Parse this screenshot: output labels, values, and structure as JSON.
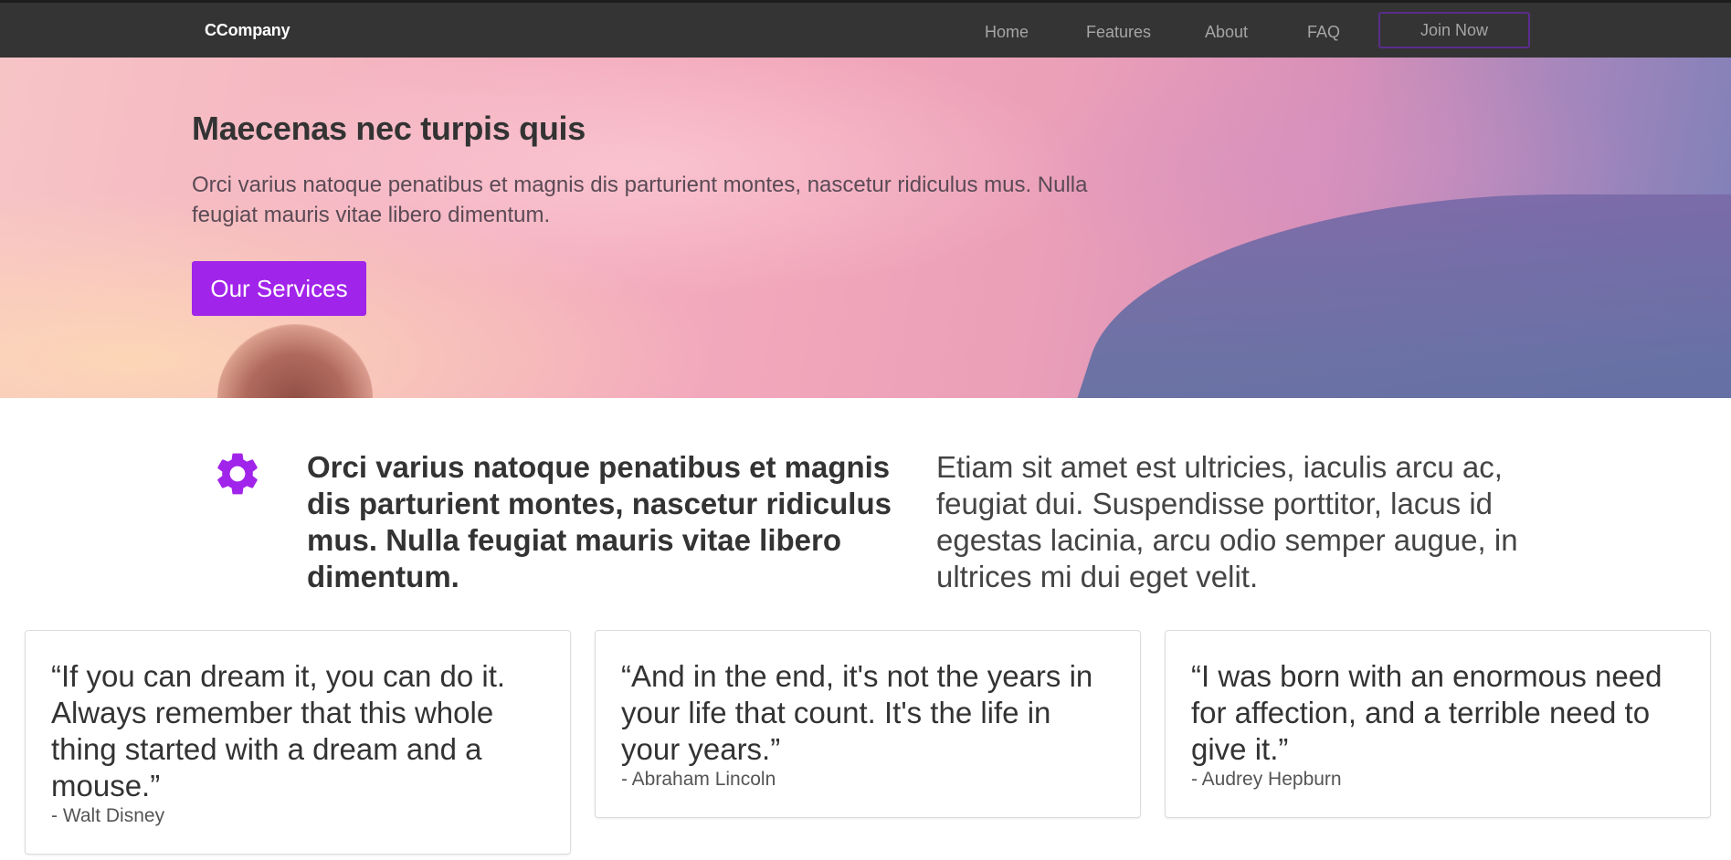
{
  "navbar": {
    "brand": "CCompany",
    "links": [
      "Home",
      "Features",
      "About",
      "FAQ"
    ],
    "join_label": "Join Now"
  },
  "hero": {
    "title": "Maecenas nec turpis quis",
    "text": "Orci varius natoque penatibus et magnis dis parturient montes, nascetur ridiculus mus. Nulla feugiat mauris vitae libero dimentum.",
    "button_label": "Our Services"
  },
  "feature": {
    "icon": "gear-icon",
    "heading": "Orci varius natoque penatibus et magnis dis parturient montes, nascetur ridiculus mus. Nulla feugiat mauris vitae libero dimentum.",
    "text": "Etiam sit amet est ultricies, iaculis arcu ac, feugiat dui. Suspendisse porttitor, lacus id egestas lacinia, arcu odio semper augue, in ultrices mi dui eget velit."
  },
  "testimonials": [
    {
      "quote": "“If you can dream it, you can do it. Always remember that this whole thing started with a dream and a mouse.”",
      "author": "- Walt Disney"
    },
    {
      "quote": "“And in the end, it's not the years in your life that count. It's the life in your years.”",
      "author": "- Abraham Lincoln"
    },
    {
      "quote": "“I was born with an enormous need for affection, and a terrible need to give it.”",
      "author": "- Audrey Hepburn"
    }
  ],
  "colors": {
    "accent": "#a124ea",
    "navbar": "#343434",
    "join_border": "#5a2d8c"
  }
}
